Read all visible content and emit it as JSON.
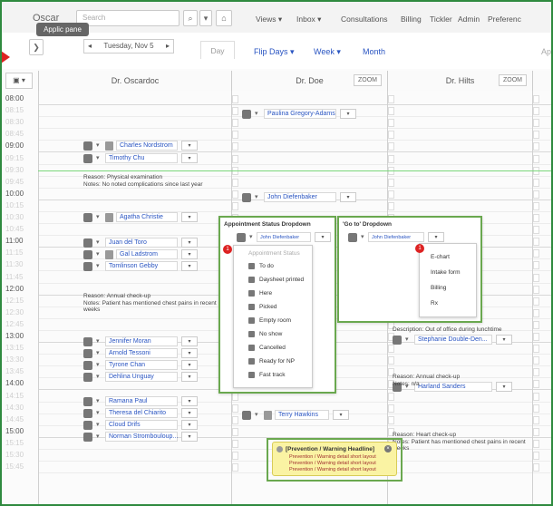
{
  "topbar": {
    "brand": "Oscar",
    "search_placeholder": "Search",
    "search_icon": "magnifier-icon",
    "home_icon": "home-icon",
    "menus": [
      "Views ▾",
      "Inbox ▾",
      "Consultations",
      "Billing",
      "Tickler",
      "Admin",
      "Preferenc"
    ],
    "tooltip": "Applic pane"
  },
  "nav": {
    "date": "Tuesday, Nov 5",
    "prev": "◂",
    "next": "▸",
    "expand": "❯",
    "day_tab": "Day",
    "flip_days": "Flip Days ▾",
    "week": "Week ▾",
    "month": "Month",
    "ap": "Ap"
  },
  "columns": [
    {
      "name": "Dr. Oscardoc",
      "zoom": ""
    },
    {
      "name": "Dr. Doe",
      "zoom": "ZOOM"
    },
    {
      "name": "Dr. Hilts",
      "zoom": "ZOOM"
    }
  ],
  "times": [
    "08:00",
    "08:15",
    "08:30",
    "08:45",
    "09:00",
    "09:15",
    "09:30",
    "09:45",
    "10:00",
    "10:15",
    "10:30",
    "10:45",
    "11:00",
    "11:15",
    "11:30",
    "11:45",
    "12:00",
    "12:15",
    "12:30",
    "12:45",
    "13:00",
    "13:15",
    "13:30",
    "13:45",
    "14:00",
    "14:15",
    "14:30",
    "14:45",
    "15:00",
    "15:15",
    "15:30",
    "15:45"
  ],
  "appointments_col1": [
    {
      "name": "Charles Nordstrom",
      "slot": 4
    },
    {
      "name": "Timothy Chu",
      "slot": 5
    },
    {
      "name": "Agatha Christie",
      "slot": 10
    },
    {
      "name": "Juan del Toro",
      "slot": 12
    },
    {
      "name": "Gal Ladstrom",
      "slot": 13
    },
    {
      "name": "Tomlinson Gebby",
      "slot": 14
    },
    {
      "name": "Jennifer Moran",
      "slot": 20
    },
    {
      "name": "Arnold Tessoni",
      "slot": 21
    },
    {
      "name": "Tyrone Chan",
      "slot": 22
    },
    {
      "name": "Dehlina Unguay",
      "slot": 23
    },
    {
      "name": "Ramana Paul",
      "slot": 25
    },
    {
      "name": "Theresa del Chiarito",
      "slot": 26
    },
    {
      "name": "Cloud Drifs",
      "slot": 27
    },
    {
      "name": "Norman Strombouloup...",
      "slot": 28
    }
  ],
  "notes_col1": [
    {
      "reason": "Reason: Physical examination",
      "notes": "Notes: No noted complications since last year"
    },
    {
      "reason": "Reason: Annual check-up",
      "notes": "Notes: Patient has mentioned chest pains in recent weeks"
    }
  ],
  "appointments_col2": [
    {
      "name": "Paulina Gregory-Adams",
      "slot": 1
    },
    {
      "name": "John Diefenbaker",
      "slot": 8
    },
    {
      "name": "Terry Hawkins",
      "slot": 26
    }
  ],
  "appointments_col3": [
    {
      "name": "Stephanie Double-Den...",
      "slot": 20
    },
    {
      "name": "Harland Sanders",
      "slot": 24
    }
  ],
  "notes_col3": [
    {
      "text": "Description: Out of office during lunchtime"
    },
    {
      "reason": "Reason: Annual check-up",
      "notes": "Notes: n/a"
    },
    {
      "reason": "Reason: Heart check-up",
      "notes": "Notes: Patient has mentioned chest pains in recent weeks"
    }
  ],
  "status_dropdown": {
    "title": "Appointment Status Dropdown",
    "patient": "John Diefenbaker",
    "header": "Appointment Status",
    "items": [
      "To do",
      "Daysheet printed",
      "Here",
      "Picked",
      "Empty room",
      "No show",
      "Cancelled",
      "Ready for NP",
      "Fast track"
    ],
    "badge": "1"
  },
  "goto_dropdown": {
    "title": "'Go to' Dropdown",
    "patient": "John Diefenbaker",
    "items": [
      "E-chart",
      "Intake form",
      "Billing",
      "Rx"
    ],
    "badge": "1"
  },
  "warning": {
    "title": "[Prevention / Warning Headline]",
    "lines": [
      "Prevention / Warning detail short layout",
      "Prevention / Warning detail short layout",
      "Prevention / Warning detail short layout"
    ],
    "close": "×"
  },
  "colors": {
    "accent_green": "#6aa84f",
    "link_blue": "#2a55c2",
    "alert_red": "#d22222",
    "warning_yellow": "#faf3a3"
  }
}
